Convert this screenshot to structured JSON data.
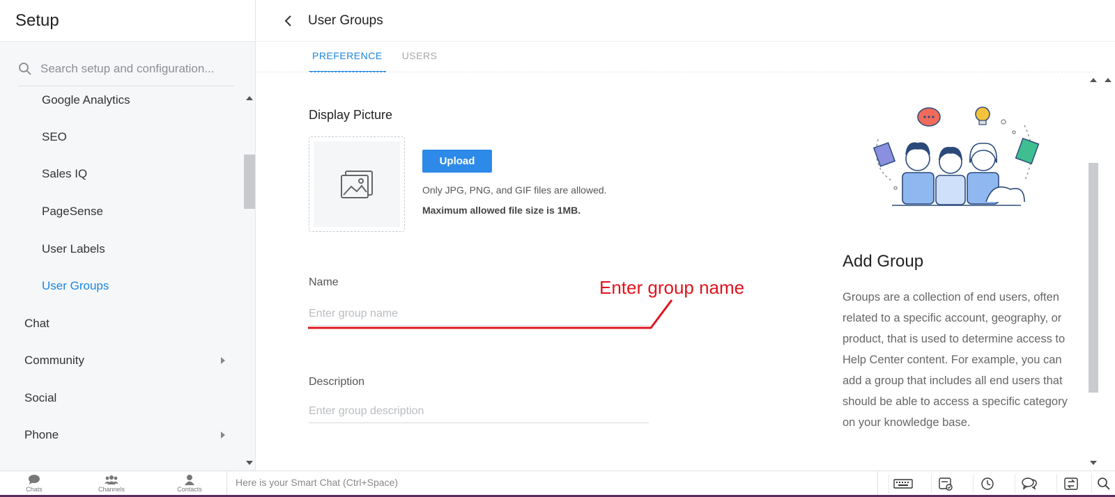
{
  "sidebar": {
    "title": "Setup",
    "search_placeholder": "Search setup and configuration...",
    "items": [
      {
        "label": "Google Analytics"
      },
      {
        "label": "SEO"
      },
      {
        "label": "Sales IQ"
      },
      {
        "label": "PageSense"
      },
      {
        "label": "User Labels"
      },
      {
        "label": "User Groups"
      },
      {
        "label": "Chat"
      },
      {
        "label": "Community"
      },
      {
        "label": "Social"
      },
      {
        "label": "Phone"
      }
    ]
  },
  "header": {
    "title": "User Groups"
  },
  "tabs": [
    {
      "label": "PREFERENCE"
    },
    {
      "label": "USERS"
    }
  ],
  "form": {
    "display_picture_title": "Display Picture",
    "upload_label": "Upload",
    "upload_hint": "Only JPG, PNG, and GIF files are allowed.",
    "upload_limit": "Maximum allowed file size is 1MB.",
    "name_label": "Name",
    "name_value": "",
    "name_placeholder": "Enter group name",
    "description_label": "Description",
    "description_value": "",
    "description_placeholder": "Enter group description"
  },
  "annotation": {
    "text": "Enter group name",
    "color": "#e0141e"
  },
  "info": {
    "title": "Add Group",
    "text": "Groups are a collection of end users, often related to a specific account, geography, or product, that is used to determine access to Help Center content. For example, you can add a group that includes all end users that should be able to access a specific category on your knowledge base."
  },
  "bottom_bar": {
    "items": [
      {
        "label": "Chats"
      },
      {
        "label": "Channels"
      },
      {
        "label": "Contacts"
      }
    ],
    "smart_chat_placeholder": "Here is your Smart Chat (Ctrl+Space)"
  },
  "colors": {
    "accent": "#1a86e0",
    "button": "#2d8ae8",
    "bottom_border": "#5b2b5e"
  }
}
